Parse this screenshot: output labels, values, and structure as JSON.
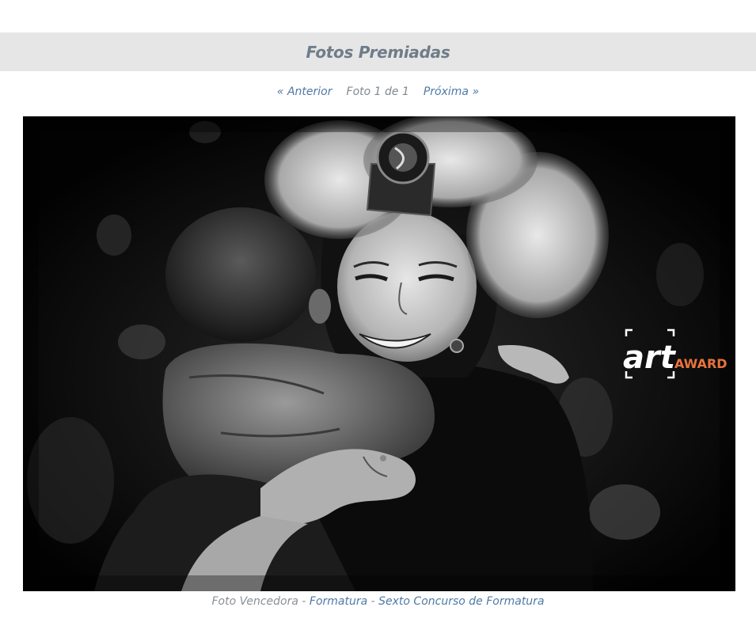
{
  "header": {
    "title": "Fotos Premiadas"
  },
  "pager": {
    "prev_label": "« Anterior",
    "count_label": "Foto 1 de 1",
    "next_label": "Próxima »"
  },
  "photo": {
    "watermark_art": "art",
    "watermark_award": "AWARD"
  },
  "caption": {
    "prefix": "Foto Vencedora",
    "separator": " - ",
    "category_link": "Formatura",
    "contest_link": "Sexto Concurso de Formatura"
  },
  "colors": {
    "link": "#4f79a6",
    "title": "#6f7c89",
    "title_bar_bg": "#e6e6e6",
    "award_orange": "#e8733a"
  }
}
